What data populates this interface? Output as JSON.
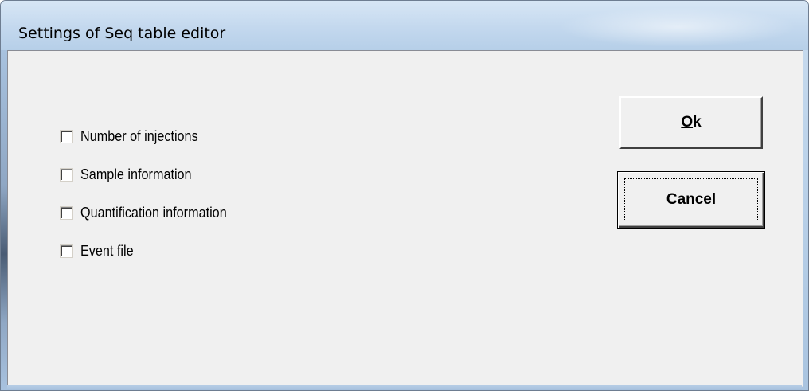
{
  "window": {
    "title": "Settings of Seq table editor"
  },
  "options": [
    {
      "label": "Number of injections",
      "checked": false
    },
    {
      "label": "Sample information",
      "checked": false
    },
    {
      "label": "Quantification information",
      "checked": false
    },
    {
      "label": "Event file",
      "checked": false
    }
  ],
  "buttons": {
    "ok": {
      "mnemonic": "O",
      "rest": "k"
    },
    "cancel": {
      "mnemonic": "C",
      "rest": "ancel"
    }
  },
  "colors": {
    "titlebar": "#c3d8ee",
    "client_background": "#f0f0f0"
  }
}
